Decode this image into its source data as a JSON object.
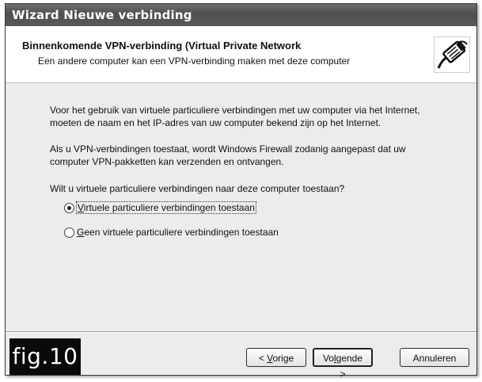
{
  "window": {
    "title": "Wizard Nieuwe verbinding"
  },
  "header": {
    "title": "Binnenkomende VPN-verbinding (Virtual Private Network",
    "subtitle": "Een andere computer kan een VPN-verbinding maken met deze computer",
    "icon": "network-cable-icon"
  },
  "body": {
    "paragraph1_line1": "Voor het gebruik van virtuele particuliere verbindingen met uw computer via het Internet,",
    "paragraph1_line2": "moeten de naam en het IP-adres van uw computer bekend zijn op het Internet.",
    "paragraph2_line1": "Als u VPN-verbindingen toestaat, wordt Windows Firewall zodanig aangepast dat uw",
    "paragraph2_line2": "computer VPN-pakketten kan verzenden en ontvangen.",
    "question": "Wilt u virtuele particuliere verbindingen naar deze computer toestaan?",
    "options": [
      {
        "mnemonic": "V",
        "rest": "irtuele particuliere verbindingen toestaan",
        "checked": true
      },
      {
        "mnemonic": "G",
        "rest": "een virtuele particuliere verbindingen toestaan",
        "checked": false
      }
    ]
  },
  "buttons": {
    "back_prefix": "< ",
    "back_mnemonic": "V",
    "back_rest": "orige",
    "next_prefix": "Vo",
    "next_mnemonic": "l",
    "next_rest": "gende >",
    "cancel": "Annuleren"
  },
  "badge": {
    "label": "fig.10"
  }
}
